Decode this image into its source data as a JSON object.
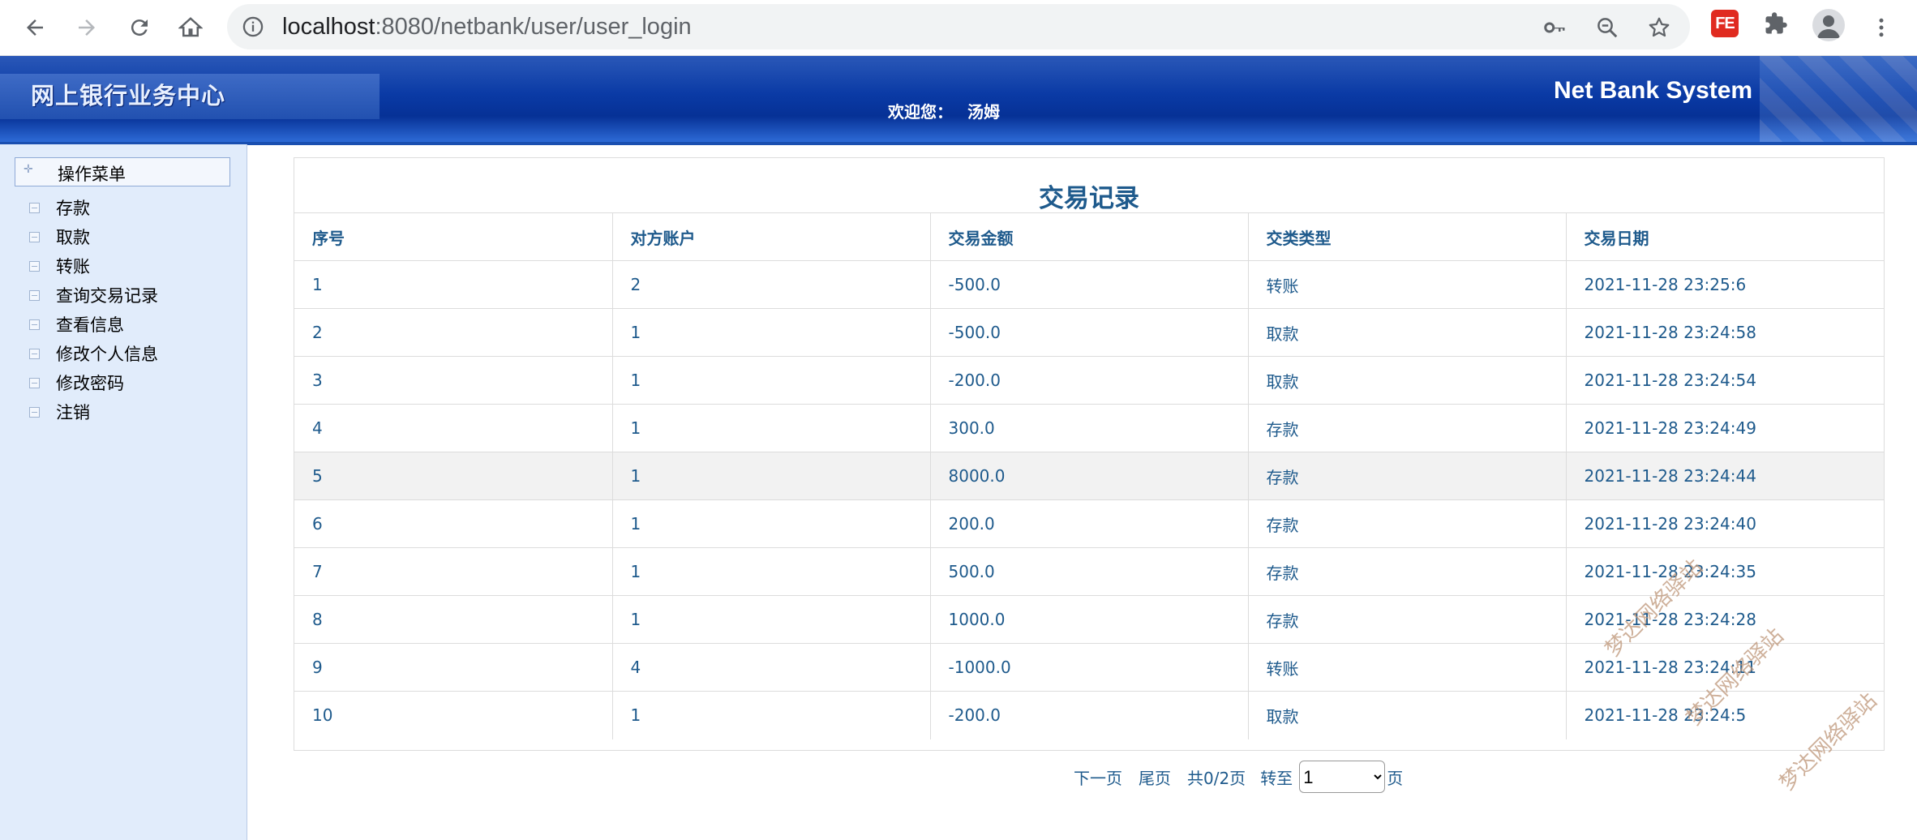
{
  "browser": {
    "url_host": "localhost",
    "url_path": ":8080/netbank/user/user_login",
    "extension_label": "FE"
  },
  "banner": {
    "title": "网上银行业务中心",
    "welcome_label": "欢迎您：",
    "user_name": "汤姆",
    "brand": "Net Bank System"
  },
  "sidebar": {
    "header": "操作菜单",
    "items": [
      {
        "label": "存款"
      },
      {
        "label": "取款"
      },
      {
        "label": "转账"
      },
      {
        "label": "查询交易记录"
      },
      {
        "label": "查看信息"
      },
      {
        "label": "修改个人信息"
      },
      {
        "label": "修改密码"
      },
      {
        "label": "注销"
      }
    ]
  },
  "main": {
    "title": "交易记录",
    "columns": [
      "序号",
      "对方账户",
      "交易金额",
      "交类类型",
      "交易日期"
    ],
    "rows": [
      [
        "1",
        "2",
        "-500.0",
        "转账",
        "2021-11-28 23:25:6"
      ],
      [
        "2",
        "1",
        "-500.0",
        "取款",
        "2021-11-28 23:24:58"
      ],
      [
        "3",
        "1",
        "-200.0",
        "取款",
        "2021-11-28 23:24:54"
      ],
      [
        "4",
        "1",
        "300.0",
        "存款",
        "2021-11-28 23:24:49"
      ],
      [
        "5",
        "1",
        "8000.0",
        "存款",
        "2021-11-28 23:24:44"
      ],
      [
        "6",
        "1",
        "200.0",
        "存款",
        "2021-11-28 23:24:40"
      ],
      [
        "7",
        "1",
        "500.0",
        "存款",
        "2021-11-28 23:24:35"
      ],
      [
        "8",
        "1",
        "1000.0",
        "存款",
        "2021-11-28 23:24:28"
      ],
      [
        "9",
        "4",
        "-1000.0",
        "转账",
        "2021-11-28 23:24:11"
      ],
      [
        "10",
        "1",
        "-200.0",
        "取款",
        "2021-11-28 23:24:5"
      ]
    ],
    "highlighted_row": 4
  },
  "pager": {
    "next": "下一页",
    "last": "尾页",
    "total": "共0/2页",
    "goto": "转至",
    "page_value": "1",
    "page_suffix": "页"
  },
  "watermark": "梦达网络驿站",
  "colors": {
    "link": "#1e5a8c",
    "banner": "#0a3aa5",
    "sidebar": "#e1ecfb"
  }
}
